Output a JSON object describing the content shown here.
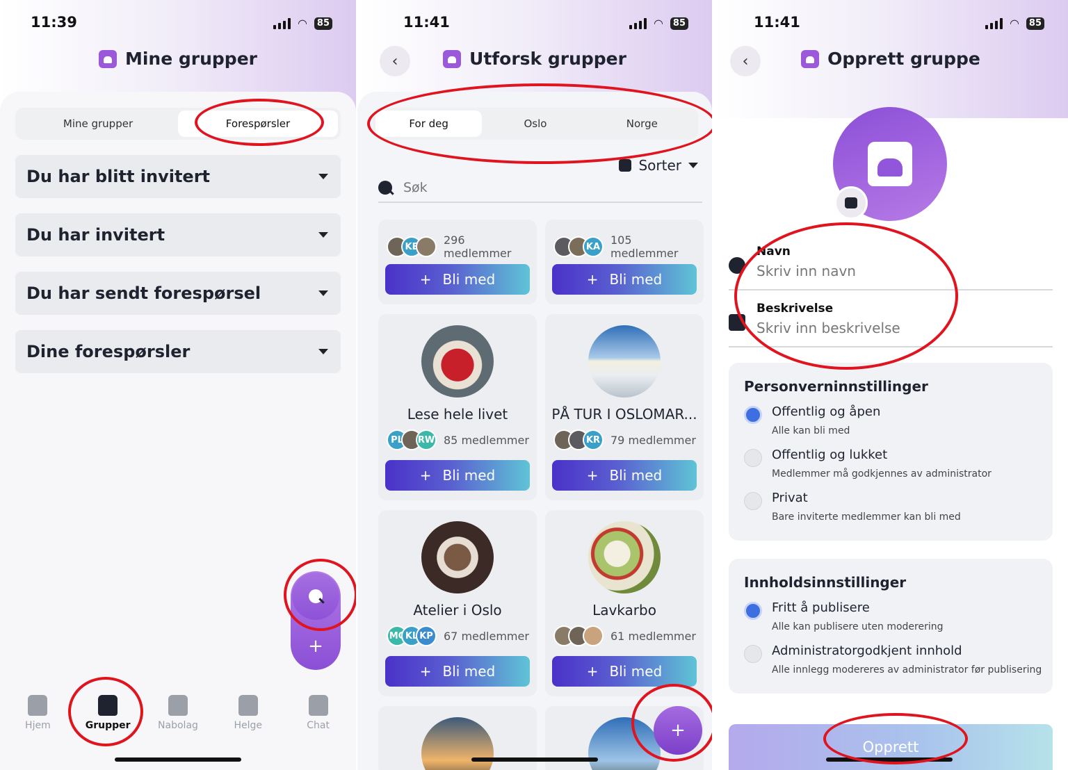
{
  "screen1": {
    "time": "11:39",
    "battery": "85",
    "title": "Mine grupper",
    "tabs": [
      "Mine grupper",
      "Forespørsler"
    ],
    "sections": [
      "Du har blitt invitert",
      "Du har invitert",
      "Du har sendt forespørsel",
      "Dine forespørsler"
    ],
    "fab_search_icon": "search-icon",
    "fab_add_label": "+",
    "nav": [
      "Hjem",
      "Grupper",
      "Nabolag",
      "Helge",
      "Chat"
    ]
  },
  "screen2": {
    "time": "11:41",
    "battery": "85",
    "title": "Utforsk grupper",
    "tabs": [
      "For deg",
      "Oslo",
      "Norge"
    ],
    "sort_label": "Sorter",
    "search_placeholder": "Søk",
    "join_label": "Bli med",
    "join_plus": "+",
    "groups": [
      {
        "name": "",
        "members": "296 medlemmer",
        "avatars": [
          "",
          "KE",
          ""
        ]
      },
      {
        "name": "",
        "members": "105 medlemmer",
        "avatars": [
          "",
          "",
          "KA"
        ]
      },
      {
        "name": "Lese hele livet",
        "members": "85 medlemmer",
        "avatars": [
          "PL",
          "",
          "RW"
        ]
      },
      {
        "name": "PÅ TUR I OSLOMAR...",
        "members": "79 medlemmer",
        "avatars": [
          "",
          "",
          "KR"
        ]
      },
      {
        "name": "Atelier i Oslo",
        "members": "67 medlemmer",
        "avatars": [
          "MC",
          "KL",
          "KP"
        ]
      },
      {
        "name": "Lavkarbo",
        "members": "61 medlemmer",
        "avatars": [
          "",
          "",
          ""
        ]
      }
    ],
    "fab_add_label": "+"
  },
  "screen3": {
    "time": "11:41",
    "battery": "85",
    "title": "Opprett gruppe",
    "name_label": "Navn",
    "name_placeholder": "Skriv inn navn",
    "desc_label": "Beskrivelse",
    "desc_placeholder": "Skriv inn beskrivelse",
    "privacy": {
      "title": "Personverninnstillinger",
      "options": [
        {
          "title": "Offentlig og åpen",
          "desc": "Alle kan bli med",
          "selected": true
        },
        {
          "title": "Offentlig og lukket",
          "desc": "Medlemmer må godkjennes av administrator",
          "selected": false
        },
        {
          "title": "Privat",
          "desc": "Bare inviterte medlemmer kan bli med",
          "selected": false
        }
      ]
    },
    "content": {
      "title": "Innholdsinnstillinger",
      "options": [
        {
          "title": "Fritt å publisere",
          "desc": "Alle kan publisere uten moderering",
          "selected": true
        },
        {
          "title": "Administratorgodkjent innhold",
          "desc": "Alle innlegg modereres av administrator før publisering",
          "selected": false
        }
      ]
    },
    "create_label": "Opprett"
  },
  "colors": {
    "accent": "#8b4fd8",
    "highlight_ring": "#e0141e",
    "join_start": "#4a31c9",
    "join_end": "#5fc4d6"
  }
}
